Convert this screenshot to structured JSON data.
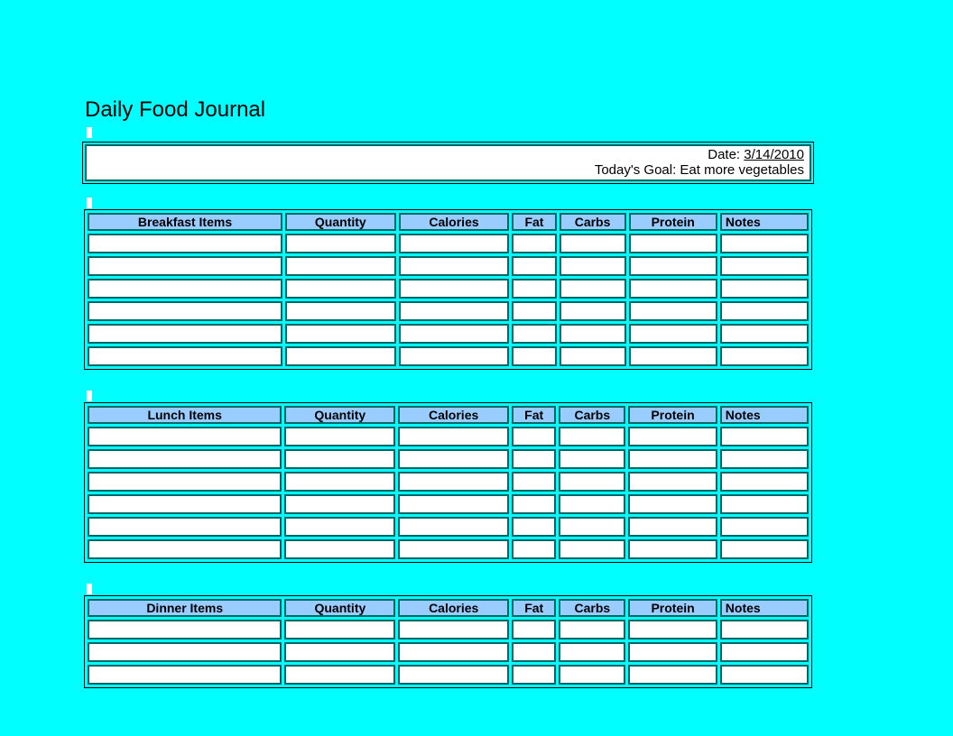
{
  "title": "Daily Food Journal",
  "info": {
    "date_label": "Date: ",
    "date_value": "3/14/2010",
    "goal_label": "Today's Goal: ",
    "goal_value": "Eat more vegetables"
  },
  "columns": {
    "quantity": "Quantity",
    "calories": "Calories",
    "fat": "Fat",
    "carbs": "Carbs",
    "protein": "Protein",
    "notes": "Notes"
  },
  "sections": {
    "breakfast": {
      "items_header": "Breakfast Items",
      "row_count": 6
    },
    "lunch": {
      "items_header": "Lunch Items",
      "row_count": 6
    },
    "dinner": {
      "items_header": "Dinner Items",
      "row_count": 3
    }
  }
}
